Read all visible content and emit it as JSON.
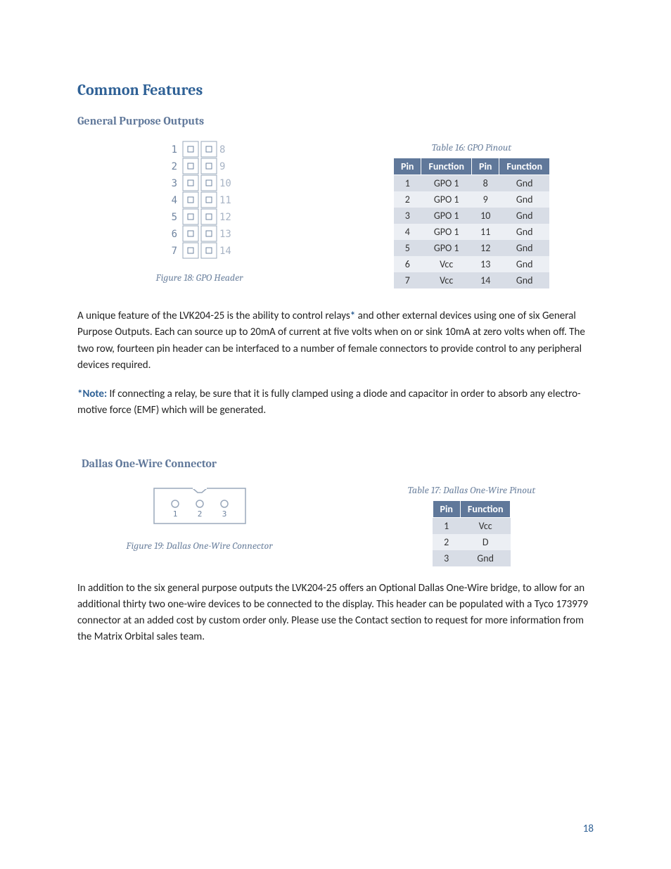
{
  "section_title": "Common Features",
  "gpo": {
    "subtitle": "General Purpose Outputs",
    "figure_caption": "Figure 18: GPO Header",
    "table_caption": "Table 16: GPO Pinout",
    "left_pins": [
      "1",
      "2",
      "3",
      "4",
      "5",
      "6",
      "7"
    ],
    "right_pins": [
      "8",
      "9",
      "10",
      "11",
      "12",
      "13",
      "14"
    ],
    "table_headers": [
      "Pin",
      "Function",
      "Pin",
      "Function"
    ],
    "table_rows": [
      [
        "1",
        "GPO 1",
        "8",
        "Gnd"
      ],
      [
        "2",
        "GPO 1",
        "9",
        "Gnd"
      ],
      [
        "3",
        "GPO 1",
        "10",
        "Gnd"
      ],
      [
        "4",
        "GPO 1",
        "11",
        "Gnd"
      ],
      [
        "5",
        "GPO 1",
        "12",
        "Gnd"
      ],
      [
        "6",
        "Vcc",
        "13",
        "Gnd"
      ],
      [
        "7",
        "Vcc",
        "14",
        "Gnd"
      ]
    ],
    "para_before_ast": "A unique feature of the LVK204-25 is the ability to control relays",
    "ast": "*",
    "para_after_ast": " and other external devices using one of six General Purpose Outputs.  Each can source up to 20mA of current at five volts when on or sink 10mA at zero volts when off.  The two row, fourteen pin header can be interfaced to a number of female connectors to provide control to any peripheral devices required.",
    "note_label": "*Note:",
    "note_text": " If connecting a relay, be sure that it is fully clamped using a diode and capacitor in order to absorb any electro-motive force (EMF) which will be generated."
  },
  "dallas": {
    "subtitle": "Dallas One-Wire Connector",
    "figure_caption": "Figure 19: Dallas One-Wire Connector",
    "table_caption": "Table 17: Dallas One-Wire Pinout",
    "pin_labels": [
      "1",
      "2",
      "3"
    ],
    "table_headers": [
      "Pin",
      "Function"
    ],
    "table_rows": [
      [
        "1",
        "Vcc"
      ],
      [
        "2",
        "D"
      ],
      [
        "3",
        "Gnd"
      ]
    ],
    "para": "In addition to the six general purpose outputs the LVK204-25 offers an Optional Dallas One-Wire bridge, to allow for an additional thirty two one-wire devices to be connected to the display.  This header can be populated with a Tyco 173979 connector at an added cost by custom order only.  Please use the Contact section to request for more information from the Matrix Orbital sales team."
  },
  "page_number": "18"
}
